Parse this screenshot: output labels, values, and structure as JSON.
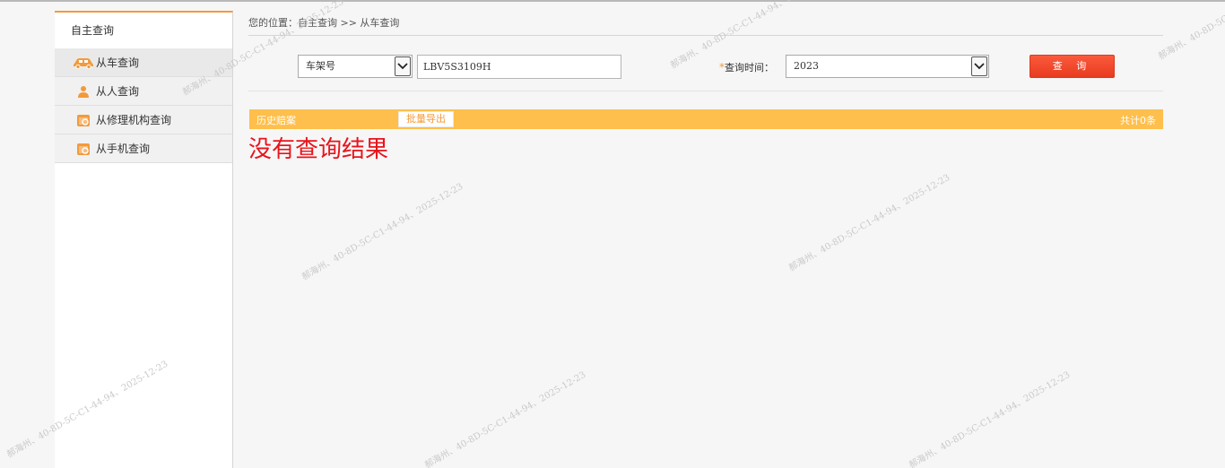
{
  "sidebar": {
    "title": "自主查询",
    "items": [
      {
        "label": "从车查询",
        "icon": "car-icon"
      },
      {
        "label": "从人查询",
        "icon": "person-icon"
      },
      {
        "label": "从修理机构查询",
        "icon": "repair-shop-icon"
      },
      {
        "label": "从手机查询",
        "icon": "phone-icon"
      }
    ]
  },
  "breadcrumb": "您的位置：自主查询 >> 从车查询",
  "search": {
    "type_select_value": "车架号",
    "vin_value": "LBV5S3109H",
    "time_label": "查询时间：",
    "required_mark": "*",
    "time_select_value": "2023",
    "search_button": "查 询"
  },
  "results": {
    "title": "历史赔案",
    "export_button": "批量导出",
    "count": "共计0条",
    "empty_message": "没有查询结果"
  },
  "watermark": "郝海州、40-8D-5C-C1-44-94、2025-12-23",
  "colors": {
    "accent_orange": "#f39a3b",
    "result_bar": "#ffbf4c",
    "button_red": "#f04a2c",
    "empty_text": "#e8141c"
  }
}
